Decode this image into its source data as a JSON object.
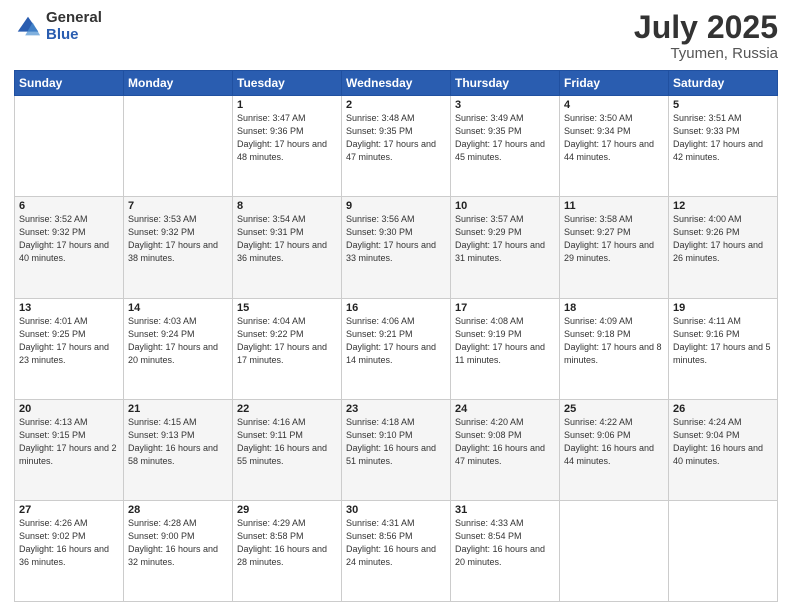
{
  "header": {
    "logo_general": "General",
    "logo_blue": "Blue",
    "title": "July 2025",
    "location": "Tyumen, Russia"
  },
  "weekdays": [
    "Sunday",
    "Monday",
    "Tuesday",
    "Wednesday",
    "Thursday",
    "Friday",
    "Saturday"
  ],
  "weeks": [
    [
      {
        "day": "",
        "info": ""
      },
      {
        "day": "",
        "info": ""
      },
      {
        "day": "1",
        "info": "Sunrise: 3:47 AM\nSunset: 9:36 PM\nDaylight: 17 hours\nand 48 minutes."
      },
      {
        "day": "2",
        "info": "Sunrise: 3:48 AM\nSunset: 9:35 PM\nDaylight: 17 hours\nand 47 minutes."
      },
      {
        "day": "3",
        "info": "Sunrise: 3:49 AM\nSunset: 9:35 PM\nDaylight: 17 hours\nand 45 minutes."
      },
      {
        "day": "4",
        "info": "Sunrise: 3:50 AM\nSunset: 9:34 PM\nDaylight: 17 hours\nand 44 minutes."
      },
      {
        "day": "5",
        "info": "Sunrise: 3:51 AM\nSunset: 9:33 PM\nDaylight: 17 hours\nand 42 minutes."
      }
    ],
    [
      {
        "day": "6",
        "info": "Sunrise: 3:52 AM\nSunset: 9:32 PM\nDaylight: 17 hours\nand 40 minutes."
      },
      {
        "day": "7",
        "info": "Sunrise: 3:53 AM\nSunset: 9:32 PM\nDaylight: 17 hours\nand 38 minutes."
      },
      {
        "day": "8",
        "info": "Sunrise: 3:54 AM\nSunset: 9:31 PM\nDaylight: 17 hours\nand 36 minutes."
      },
      {
        "day": "9",
        "info": "Sunrise: 3:56 AM\nSunset: 9:30 PM\nDaylight: 17 hours\nand 33 minutes."
      },
      {
        "day": "10",
        "info": "Sunrise: 3:57 AM\nSunset: 9:29 PM\nDaylight: 17 hours\nand 31 minutes."
      },
      {
        "day": "11",
        "info": "Sunrise: 3:58 AM\nSunset: 9:27 PM\nDaylight: 17 hours\nand 29 minutes."
      },
      {
        "day": "12",
        "info": "Sunrise: 4:00 AM\nSunset: 9:26 PM\nDaylight: 17 hours\nand 26 minutes."
      }
    ],
    [
      {
        "day": "13",
        "info": "Sunrise: 4:01 AM\nSunset: 9:25 PM\nDaylight: 17 hours\nand 23 minutes."
      },
      {
        "day": "14",
        "info": "Sunrise: 4:03 AM\nSunset: 9:24 PM\nDaylight: 17 hours\nand 20 minutes."
      },
      {
        "day": "15",
        "info": "Sunrise: 4:04 AM\nSunset: 9:22 PM\nDaylight: 17 hours\nand 17 minutes."
      },
      {
        "day": "16",
        "info": "Sunrise: 4:06 AM\nSunset: 9:21 PM\nDaylight: 17 hours\nand 14 minutes."
      },
      {
        "day": "17",
        "info": "Sunrise: 4:08 AM\nSunset: 9:19 PM\nDaylight: 17 hours\nand 11 minutes."
      },
      {
        "day": "18",
        "info": "Sunrise: 4:09 AM\nSunset: 9:18 PM\nDaylight: 17 hours\nand 8 minutes."
      },
      {
        "day": "19",
        "info": "Sunrise: 4:11 AM\nSunset: 9:16 PM\nDaylight: 17 hours\nand 5 minutes."
      }
    ],
    [
      {
        "day": "20",
        "info": "Sunrise: 4:13 AM\nSunset: 9:15 PM\nDaylight: 17 hours\nand 2 minutes."
      },
      {
        "day": "21",
        "info": "Sunrise: 4:15 AM\nSunset: 9:13 PM\nDaylight: 16 hours\nand 58 minutes."
      },
      {
        "day": "22",
        "info": "Sunrise: 4:16 AM\nSunset: 9:11 PM\nDaylight: 16 hours\nand 55 minutes."
      },
      {
        "day": "23",
        "info": "Sunrise: 4:18 AM\nSunset: 9:10 PM\nDaylight: 16 hours\nand 51 minutes."
      },
      {
        "day": "24",
        "info": "Sunrise: 4:20 AM\nSunset: 9:08 PM\nDaylight: 16 hours\nand 47 minutes."
      },
      {
        "day": "25",
        "info": "Sunrise: 4:22 AM\nSunset: 9:06 PM\nDaylight: 16 hours\nand 44 minutes."
      },
      {
        "day": "26",
        "info": "Sunrise: 4:24 AM\nSunset: 9:04 PM\nDaylight: 16 hours\nand 40 minutes."
      }
    ],
    [
      {
        "day": "27",
        "info": "Sunrise: 4:26 AM\nSunset: 9:02 PM\nDaylight: 16 hours\nand 36 minutes."
      },
      {
        "day": "28",
        "info": "Sunrise: 4:28 AM\nSunset: 9:00 PM\nDaylight: 16 hours\nand 32 minutes."
      },
      {
        "day": "29",
        "info": "Sunrise: 4:29 AM\nSunset: 8:58 PM\nDaylight: 16 hours\nand 28 minutes."
      },
      {
        "day": "30",
        "info": "Sunrise: 4:31 AM\nSunset: 8:56 PM\nDaylight: 16 hours\nand 24 minutes."
      },
      {
        "day": "31",
        "info": "Sunrise: 4:33 AM\nSunset: 8:54 PM\nDaylight: 16 hours\nand 20 minutes."
      },
      {
        "day": "",
        "info": ""
      },
      {
        "day": "",
        "info": ""
      }
    ]
  ]
}
